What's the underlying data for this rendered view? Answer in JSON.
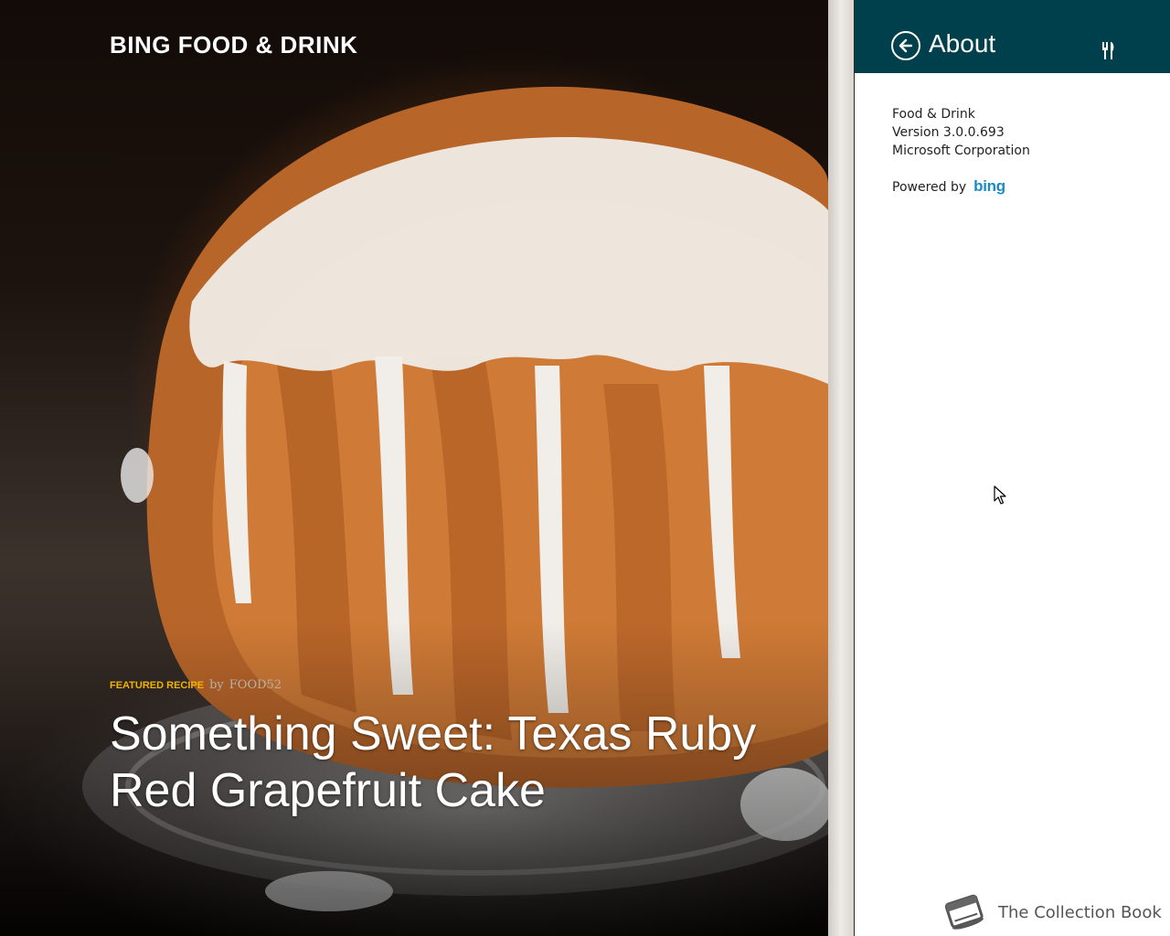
{
  "app": {
    "brand": "BING FOOD & DRINK"
  },
  "hero": {
    "featured_tag": "Featured Recipe",
    "featured_by": "by",
    "featured_author": "FOOD52",
    "title": "Something Sweet: Texas Ruby Red Grapefruit Cake"
  },
  "flyout": {
    "title": "About",
    "app_name": "Food & Drink",
    "version": "Version 3.0.0.693",
    "publisher": "Microsoft Corporation",
    "powered_by": "Powered by",
    "powered_logo": "bing"
  },
  "overlay": {
    "label": "The Collection Book"
  },
  "icons": {
    "back": "back-arrow-circle-icon",
    "app": "fork-knife-icon",
    "book": "book-icon",
    "cursor": "mouse-pointer-icon"
  },
  "colors": {
    "flyout_header": "#00404d",
    "featured_tag": "#f0b400",
    "bing_blue": "#1a8ac8"
  }
}
